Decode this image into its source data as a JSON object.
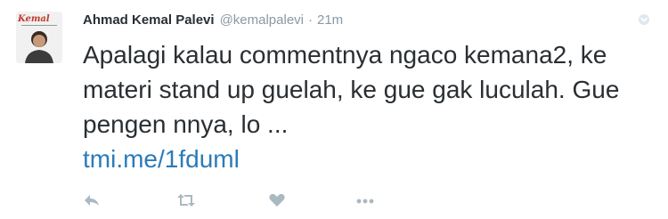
{
  "tweet": {
    "author_name": "Ahmad Kemal Palevi",
    "handle": "@kemalpalevi",
    "separator": "·",
    "time": "21m",
    "avatar_text": "Kemal",
    "text": "Apalagi kalau commentnya ngaco kemana2, ke materi stand up guelah, ke gue gak luculah. Gue pengen nnya, lo ...",
    "link": "tmi.me/1fduml"
  },
  "actions": [
    "reply-icon",
    "retweet-icon",
    "like-icon",
    "more-icon"
  ],
  "colors": {
    "text": "#292f33",
    "muted": "#8899a6",
    "link": "#2b7bb9",
    "icon": "#aab8c2"
  }
}
